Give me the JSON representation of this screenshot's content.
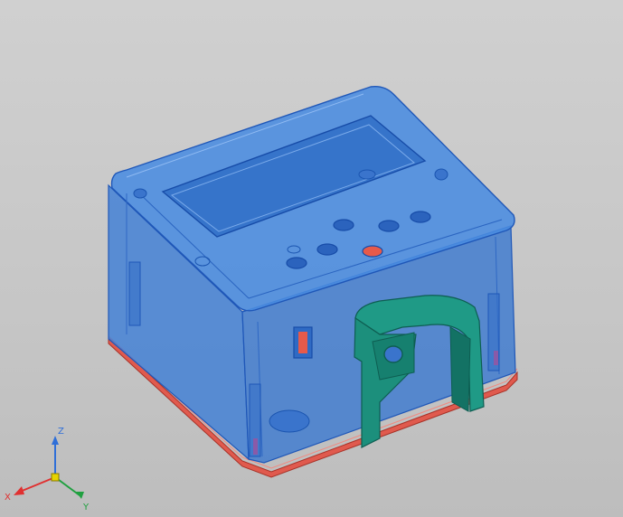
{
  "viewport": {
    "background": "#c8c8c8",
    "colors": {
      "housing_body": "#3f7fd6",
      "housing_edge": "#1f57b8",
      "base_plate": "#e05a4e",
      "bracket": "#1f9a86",
      "bracket_dark": "#137264",
      "switch_window": "#e65a4a"
    }
  },
  "model": {
    "housing": "housing-icon",
    "bracket": "bracket-icon",
    "base": "base-plate-icon"
  },
  "triad": {
    "x_label": "X",
    "y_label": "Y",
    "z_label": "Z",
    "x_color": "#e03030",
    "y_color": "#20a040",
    "z_color": "#2f6fd8"
  }
}
